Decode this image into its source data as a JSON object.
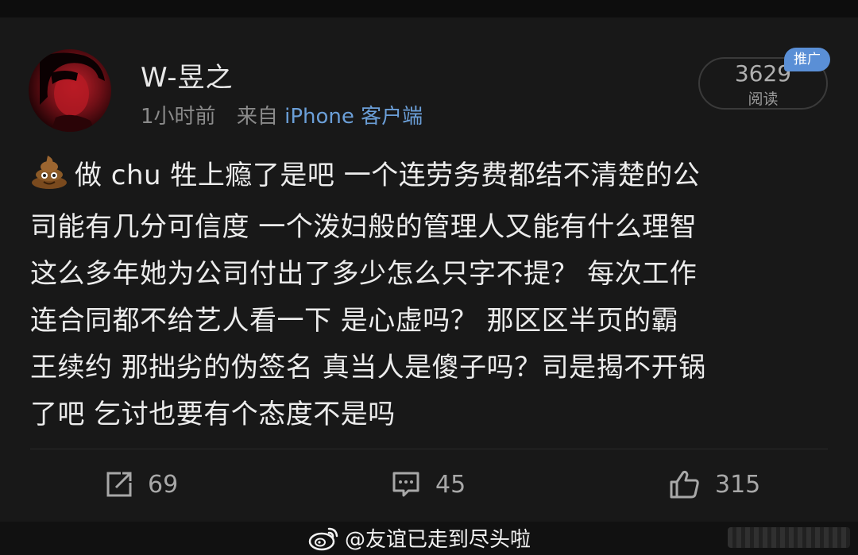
{
  "post": {
    "username": "W-昱之",
    "time": "1小时前",
    "source_prefix": "来自",
    "source_client": "iPhone 客户端",
    "read_count": "3629",
    "read_label": "阅读",
    "promo_badge": "推广",
    "lines": [
      "做 chu 牲上瘾了是吧  一个连劳务费都结不清楚的公",
      "司能有几分可信度 一个泼妇般的管理人又能有什么理智",
      "这么多年她为公司付出了多少怎么只字不提？ 每次工作",
      "连合同都不给艺人看一下 是心虚吗？  那区区半页的霸",
      "王续约 那拙劣的伪签名 真当人是傻子吗？司是揭不开锅",
      "了吧 乞讨也要有个态度不是吗"
    ]
  },
  "actions": {
    "repost_count": "69",
    "comment_count": "45",
    "like_count": "315"
  },
  "watermark": {
    "text": "@友谊已走到尽头啦"
  },
  "icons": {
    "emoji": "poop-emoji",
    "repost": "repost-icon",
    "comment": "comment-icon",
    "like": "thumbs-up-icon",
    "weibo": "weibo-logo-icon"
  },
  "colors": {
    "background": "#181818",
    "link": "#6b9fd8",
    "badge": "#5a8fd6"
  }
}
